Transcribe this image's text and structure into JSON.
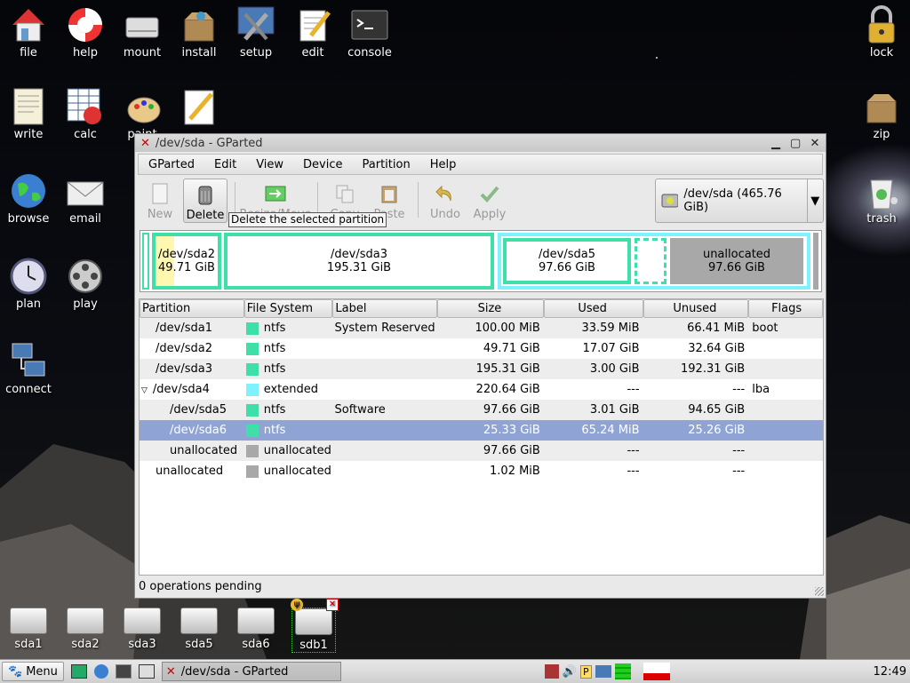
{
  "desktop": {
    "icons_top": [
      {
        "label": "file",
        "icon": "home-icon"
      },
      {
        "label": "help",
        "icon": "lifebuoy-icon"
      },
      {
        "label": "mount",
        "icon": "drive-icon"
      },
      {
        "label": "install",
        "icon": "package-icon"
      },
      {
        "label": "setup",
        "icon": "tools-icon"
      },
      {
        "label": "edit",
        "icon": "notepad-icon"
      },
      {
        "label": "console",
        "icon": "terminal-icon"
      }
    ],
    "icons_left": [
      {
        "label": "write",
        "icon": "document-icon"
      },
      {
        "label": "calc",
        "icon": "spreadsheet-icon"
      },
      {
        "label": "paint",
        "icon": "palette-icon"
      },
      {
        "label": "",
        "icon": "pencil-icon"
      },
      {
        "label": "browse",
        "icon": "globe-icon"
      },
      {
        "label": "email",
        "icon": "envelope-icon"
      },
      {
        "label": "plan",
        "icon": "clock-icon"
      },
      {
        "label": "play",
        "icon": "film-reel-icon"
      },
      {
        "label": "connect",
        "icon": "network-icon"
      }
    ],
    "icons_right": [
      {
        "label": "lock",
        "icon": "padlock-icon"
      },
      {
        "label": "zip",
        "icon": "box-icon"
      },
      {
        "label": "trash",
        "icon": "trash-icon"
      }
    ],
    "drives": [
      "sda1",
      "sda2",
      "sda3",
      "sda5",
      "sda6",
      "sdb1"
    ]
  },
  "window": {
    "title": "/dev/sda - GParted",
    "menus": [
      "GParted",
      "Edit",
      "View",
      "Device",
      "Partition",
      "Help"
    ],
    "toolbar": {
      "new": "New",
      "delete": "Delete",
      "resize": "Resize/Move",
      "copy": "Copy",
      "paste": "Paste",
      "undo": "Undo",
      "apply": "Apply"
    },
    "tooltip": "Delete the selected partition",
    "device": "/dev/sda  (465.76 GiB)",
    "graphic": [
      {
        "name": "/dev/sda2",
        "size": "49.71 GiB"
      },
      {
        "name": "/dev/sda3",
        "size": "195.31 GiB"
      },
      {
        "name": "/dev/sda5",
        "size": "97.66 GiB"
      },
      {
        "name": "unallocated",
        "size": "97.66 GiB"
      }
    ],
    "columns": [
      "Partition",
      "File System",
      "Label",
      "Size",
      "Used",
      "Unused",
      "Flags"
    ],
    "rows": [
      {
        "partition": "/dev/sda1",
        "fs": "ntfs",
        "fs_color": "#3fe0a8",
        "label": "System Reserved",
        "size": "100.00 MiB",
        "used": "33.59 MiB",
        "unused": "66.41 MiB",
        "flags": "boot"
      },
      {
        "partition": "/dev/sda2",
        "fs": "ntfs",
        "fs_color": "#3fe0a8",
        "label": "",
        "size": "49.71 GiB",
        "used": "17.07 GiB",
        "unused": "32.64 GiB",
        "flags": ""
      },
      {
        "partition": "/dev/sda3",
        "fs": "ntfs",
        "fs_color": "#3fe0a8",
        "label": "",
        "size": "195.31 GiB",
        "used": "3.00 GiB",
        "unused": "192.31 GiB",
        "flags": ""
      },
      {
        "partition": "/dev/sda4",
        "fs": "extended",
        "fs_color": "#7ff2ff",
        "label": "",
        "size": "220.64 GiB",
        "used": "---",
        "unused": "---",
        "flags": "lba"
      },
      {
        "partition": "/dev/sda5",
        "fs": "ntfs",
        "fs_color": "#3fe0a8",
        "label": "Software",
        "size": "97.66 GiB",
        "used": "3.01 GiB",
        "unused": "94.65 GiB",
        "flags": ""
      },
      {
        "partition": "/dev/sda6",
        "fs": "ntfs",
        "fs_color": "#3fe0a8",
        "label": "",
        "size": "25.33 GiB",
        "used": "65.24 MiB",
        "unused": "25.26 GiB",
        "flags": ""
      },
      {
        "partition": "unallocated",
        "fs": "unallocated",
        "fs_color": "#a8a8a8",
        "label": "",
        "size": "97.66 GiB",
        "used": "---",
        "unused": "---",
        "flags": ""
      },
      {
        "partition": "unallocated",
        "fs": "unallocated",
        "fs_color": "#a8a8a8",
        "label": "",
        "size": "1.02 MiB",
        "used": "---",
        "unused": "---",
        "flags": ""
      }
    ],
    "status": "0 operations pending"
  },
  "taskbar": {
    "menu": "Menu",
    "task": "/dev/sda - GParted",
    "clock": "12:49"
  }
}
